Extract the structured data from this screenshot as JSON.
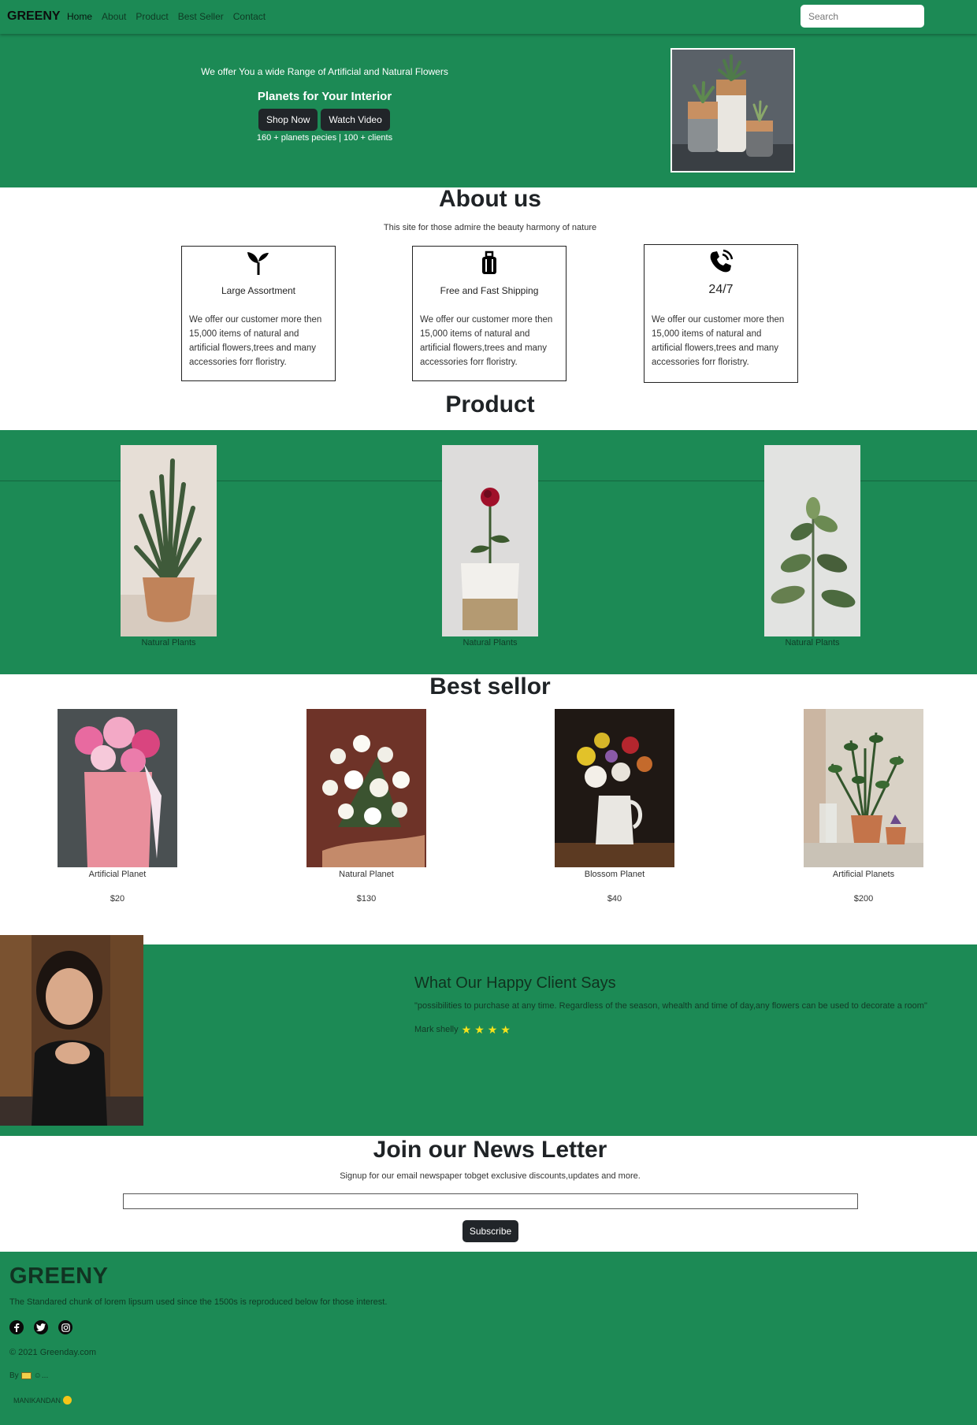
{
  "navbar": {
    "brand": "GREENY",
    "links": [
      "Home",
      "About",
      "Product",
      "Best Seller",
      "Contact"
    ],
    "search_placeholder": "Search"
  },
  "hero": {
    "tagline": "We offer You a wide Range of Artificial and Natural Flowers",
    "title": "Planets for Your Interior",
    "shop_now": "Shop Now",
    "watch_video": "Watch Video",
    "stats": "160 + planets pecies | 100 + clients"
  },
  "about": {
    "heading": "About us",
    "subtitle": "This site for those admire the beauty harmony of nature",
    "cards": [
      {
        "icon": "sprout-icon",
        "title": "Large Assortment",
        "text": "We offer our customer more then 15,000 items of natural and artificial flowers,trees and many accessories forr floristry."
      },
      {
        "icon": "suitcase-icon",
        "title": "Free and Fast Shipping",
        "text": "We offer our customer more then 15,000 items of natural and artificial flowers,trees and many accessories forr floristry."
      },
      {
        "icon": "phone-icon",
        "title": "24/7",
        "text": "We offer our customer more then 15,000 items of natural and artificial flowers,trees and many accessories forr floristry."
      }
    ]
  },
  "product": {
    "heading": "Product",
    "items": [
      {
        "caption": "Natural Plants"
      },
      {
        "caption": "Natural Plants"
      },
      {
        "caption": "Natural Plants"
      }
    ]
  },
  "best_seller": {
    "heading": "Best sellor",
    "items": [
      {
        "name": "Artificial Planet",
        "price": "$20"
      },
      {
        "name": "Natural Planet",
        "price": "$130"
      },
      {
        "name": "Blossom Planet",
        "price": "$40"
      },
      {
        "name": "Artificial Planets",
        "price": "$200"
      }
    ]
  },
  "testimonial": {
    "title": "What Our Happy Client Says",
    "quote": "\"possibilities to purchase at any time. Regardless of the season, whealth and time of day,any flowers can be used to decorate a room\"",
    "author": "Mark shelly",
    "rating": 4
  },
  "newsletter": {
    "heading": "Join our News Letter",
    "subtitle": "Signup for our email newspaper tobget exclusive discounts,updates and more.",
    "subscribe": "Subscribe"
  },
  "footer": {
    "brand": "GREENY",
    "text": "The Standared chunk of lorem lipsum used since the 1500s is reproduced below for those interest.",
    "socials": [
      "facebook-icon",
      "twitter-icon",
      "instagram-icon"
    ],
    "copyright": "© 2021 Greenday.com",
    "by": "By",
    "by_suffix": "☺...",
    "maker": "MANIKANDAN"
  },
  "colors": {
    "brand_green": "#1c8a55",
    "dark_button": "#212529",
    "star": "#f4e21b"
  }
}
